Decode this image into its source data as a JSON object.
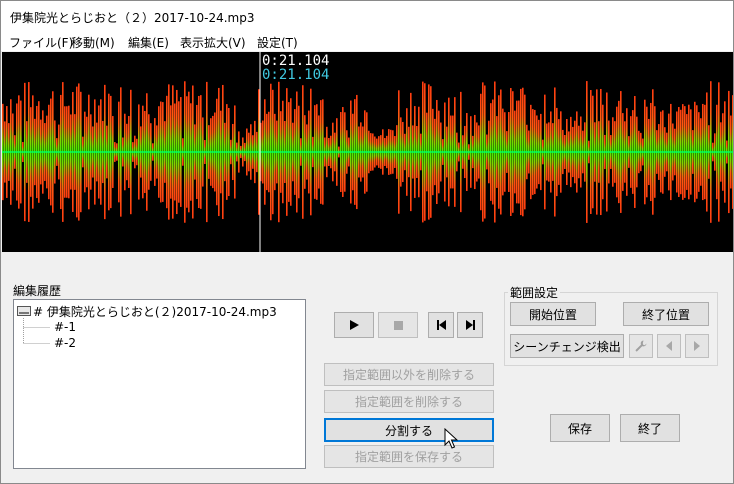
{
  "window": {
    "title": "伊集院光とらじおと（２）2017-10-24.mp3"
  },
  "menu": [
    {
      "label": "ファイル(F)"
    },
    {
      "label": "移動(M)"
    },
    {
      "label": "編集(E)"
    },
    {
      "label": "表示拡大(V)"
    },
    {
      "label": "設定(T)"
    }
  ],
  "waveform": {
    "cursor_time_white": "0:21.104",
    "cursor_time_cyan": "0:21.104",
    "colors": {
      "background": "#000000",
      "peak": "#ff4010",
      "core": "#40e000",
      "center_line": "#00ff60",
      "cursor": "#ffffff",
      "time_cyan": "#40c8e0"
    }
  },
  "history": {
    "label": "編集履歴",
    "items": [
      {
        "label": "# 伊集院光とらじおと(２)2017-10-24.mp3"
      },
      {
        "label": "#-1"
      },
      {
        "label": "#-2"
      }
    ]
  },
  "transport": {
    "play_icon": "play-icon",
    "stop_icon": "stop-icon",
    "prev_icon": "skip-back-icon",
    "next_icon": "skip-forward-icon"
  },
  "actions": {
    "delete_outside": "指定範囲以外を削除する",
    "delete_range": "指定範囲を削除する",
    "split": "分割する",
    "save_range": "指定範囲を保存する"
  },
  "range": {
    "title": "範囲設定",
    "start": "開始位置",
    "end": "終了位置",
    "scene_detect": "シーンチェンジ検出",
    "wrench_icon": "wrench-icon"
  },
  "footer": {
    "save": "保存",
    "exit": "終了"
  }
}
